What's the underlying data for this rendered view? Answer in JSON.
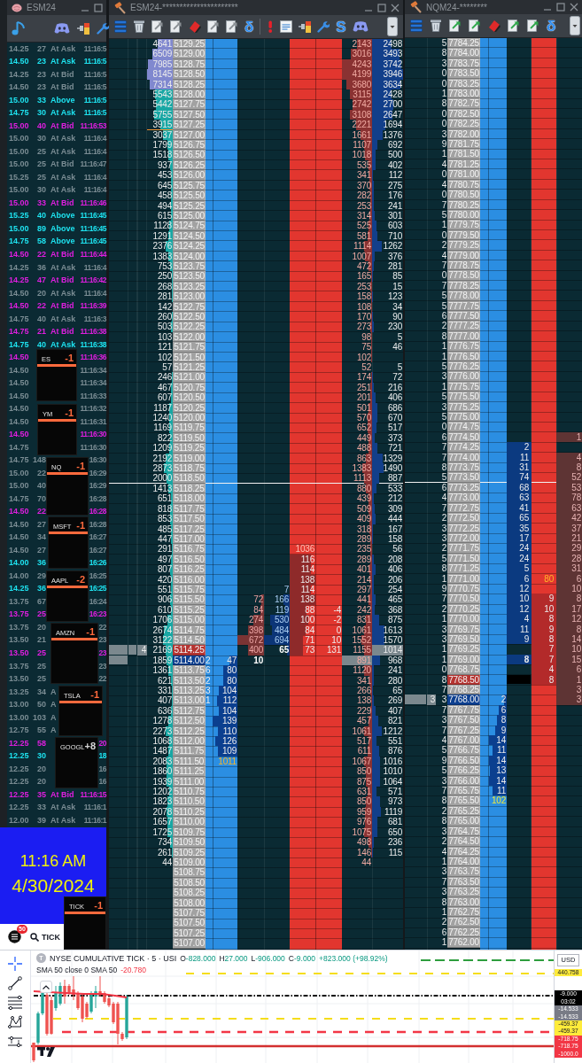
{
  "time_sales": {
    "title": "ESM24",
    "rows": [
      {
        "column_1": "14.25",
        "column_2": "27",
        "column_3": "At Ask",
        "column_4": "11:16:5",
        "color": "#7b8d94"
      },
      {
        "column_1": "14.50",
        "column_2": "23",
        "column_3": "At Ask",
        "column_4": "11:16:5",
        "color": "#1ee3f0"
      },
      {
        "column_1": "14.25",
        "column_2": "23",
        "column_3": "At Bid",
        "column_4": "11:16:5",
        "color": "#7b8d94"
      },
      {
        "column_1": "14.50",
        "column_2": "23",
        "column_3": "At Bid",
        "column_4": "11:16:5",
        "color": "#7b8d94"
      },
      {
        "column_1": "15.00",
        "column_2": "33",
        "column_3": "Above",
        "column_4": "11:16:5",
        "color": "#1ee3f0"
      },
      {
        "column_1": "14.75",
        "column_2": "30",
        "column_3": "At Ask",
        "column_4": "11:16:5",
        "color": "#1ee3f0"
      },
      {
        "column_1": "15.00",
        "column_2": "40",
        "column_3": "At Bid",
        "column_4": "11:16:53",
        "color": "#e01ee0"
      },
      {
        "column_1": "15.00",
        "column_2": "30",
        "column_3": "At Ask",
        "column_4": "11:16:4",
        "color": "#7b8d94"
      },
      {
        "column_1": "15.00",
        "column_2": "25",
        "column_3": "At Ask",
        "column_4": "11:16:4",
        "color": "#7b8d94"
      },
      {
        "column_1": "15.00",
        "column_2": "25",
        "column_3": "At Bid",
        "column_4": "11:16:47",
        "color": "#7b8d94"
      },
      {
        "column_1": "15.25",
        "column_2": "25",
        "column_3": "At Ask",
        "column_4": "11:16:4",
        "color": "#7b8d94"
      },
      {
        "column_1": "15.00",
        "column_2": "30",
        "column_3": "At Ask",
        "column_4": "11:16:4",
        "color": "#7b8d94"
      },
      {
        "column_1": "15.00",
        "column_2": "33",
        "column_3": "At Bid",
        "column_4": "11:16:46",
        "color": "#e01ee0"
      },
      {
        "column_1": "15.25",
        "column_2": "40",
        "column_3": "Above",
        "column_4": "11:16:45",
        "color": "#1ee3f0"
      },
      {
        "column_1": "15.00",
        "column_2": "89",
        "column_3": "Above",
        "column_4": "11:16:45",
        "color": "#1ee3f0"
      },
      {
        "column_1": "14.75",
        "column_2": "58",
        "column_3": "Above",
        "column_4": "11:16:45",
        "color": "#1ee3f0"
      },
      {
        "column_1": "14.50",
        "column_2": "22",
        "column_3": "At Bid",
        "column_4": "11:16:44",
        "color": "#e01ee0"
      },
      {
        "column_1": "14.25",
        "column_2": "36",
        "column_3": "At Ask",
        "column_4": "11:16:4",
        "color": "#7b8d94"
      },
      {
        "column_1": "14.25",
        "column_2": "47",
        "column_3": "At Bid",
        "column_4": "11:16:42",
        "color": "#e01ee0"
      },
      {
        "column_1": "14.50",
        "column_2": "20",
        "column_3": "At Ask",
        "column_4": "11:16:4",
        "color": "#7b8d94"
      },
      {
        "column_1": "14.50",
        "column_2": "22",
        "column_3": "At Bid",
        "column_4": "11:16:39",
        "color": "#e01ee0"
      },
      {
        "column_1": "14.75",
        "column_2": "40",
        "column_3": "At Ask",
        "column_4": "11:16:3",
        "color": "#7b8d94"
      },
      {
        "column_1": "14.75",
        "column_2": "21",
        "column_3": "At Bid",
        "column_4": "11:16:38",
        "color": "#e01ee0"
      },
      {
        "column_1": "14.75",
        "column_2": "40",
        "column_3": "At Ask",
        "column_4": "11:16:38",
        "color": "#1ee3f0"
      },
      {
        "column_1": "14.50",
        "column_4": "11:16:36",
        "color": "#e01ee0"
      },
      {
        "column_1": "14.50",
        "column_4": "11:16:34",
        "color": "#7b8d94"
      },
      {
        "column_1": "14.50",
        "column_4": "11:16:34",
        "color": "#7b8d94"
      },
      {
        "column_1": "14.50",
        "column_4": "11:16:33",
        "color": "#7b8d94"
      },
      {
        "column_1": "14.50",
        "column_4": "11:16:32",
        "color": "#7b8d94"
      },
      {
        "column_1": "14.50",
        "column_4": "11:16:31",
        "color": "#7b8d94"
      },
      {
        "column_1": "14.50",
        "column_4": "11:16:30",
        "color": "#e01ee0"
      },
      {
        "column_1": "14.75",
        "column_4": "11:16:30",
        "color": "#7b8d94"
      },
      {
        "column_1": "14.75",
        "column_2": "148",
        "column_4": "16:30",
        "color": "#7b8d94"
      },
      {
        "column_1": "15.00",
        "column_2": "22",
        "column_4": "16:29",
        "color": "#7b8d94"
      },
      {
        "column_1": "15.00",
        "column_2": "40",
        "column_4": "16:29",
        "color": "#7b8d94"
      },
      {
        "column_1": "14.75",
        "column_2": "70",
        "column_4": "16:28",
        "color": "#7b8d94"
      },
      {
        "column_1": "14.50",
        "column_2": "22",
        "column_4": "16:28",
        "color": "#e01ee0"
      },
      {
        "column_1": "14.50",
        "column_2": "27",
        "column_4": "16:28",
        "color": "#7b8d94"
      },
      {
        "column_1": "14.50",
        "column_2": "34",
        "column_4": "16:27",
        "color": "#7b8d94"
      },
      {
        "column_1": "14.50",
        "column_2": "27",
        "column_4": "16:27",
        "color": "#7b8d94"
      },
      {
        "column_1": "14.00",
        "column_2": "36",
        "column_4": "16:26",
        "color": "#1ee3f0"
      },
      {
        "column_1": "14.00",
        "column_2": "29",
        "column_4": "16:25",
        "color": "#7b8d94"
      },
      {
        "column_1": "14.25",
        "column_2": "36",
        "column_4": "16:25",
        "color": "#1ee3f0"
      },
      {
        "column_1": "13.75",
        "column_2": "67",
        "column_4": "16:24",
        "color": "#7b8d94"
      },
      {
        "column_1": "13.75",
        "column_2": "25",
        "column_4": "16:23",
        "color": "#e01ee0"
      },
      {
        "column_1": "13.75",
        "column_2": "20",
        "column_4": "22",
        "color": "#7b8d94"
      },
      {
        "column_1": "13.50",
        "column_2": "21",
        "column_4": "23",
        "color": "#7b8d94"
      },
      {
        "column_1": "13.50",
        "column_2": "25",
        "column_4": "23",
        "color": "#e01ee0"
      },
      {
        "column_1": "13.75",
        "column_2": "25",
        "column_4": "23",
        "color": "#7b8d94"
      },
      {
        "column_1": "13.50",
        "column_2": "25",
        "column_4": "22",
        "color": "#7b8d94"
      },
      {
        "column_1": "13.25",
        "column_2": "34",
        "column_3": "A",
        "color": "#7b8d94"
      },
      {
        "column_1": "13.00",
        "column_2": "50",
        "column_3": "A",
        "color": "#7b8d94"
      },
      {
        "column_1": "13.00",
        "column_2": "103",
        "column_3": "A",
        "color": "#7b8d94"
      },
      {
        "column_1": "12.75",
        "column_2": "55",
        "column_3": "A",
        "color": "#7b8d94"
      },
      {
        "column_1": "12.25",
        "column_2": "58",
        "column_4": "20",
        "color": "#e01ee0"
      },
      {
        "column_1": "12.25",
        "column_2": "30",
        "column_4": "18",
        "color": "#1ee3f0"
      },
      {
        "column_1": "12.25",
        "column_2": "20",
        "column_4": "16",
        "color": "#7b8d94"
      },
      {
        "column_1": "12.25",
        "column_2": "20",
        "column_4": "16",
        "color": "#7b8d94"
      },
      {
        "column_1": "12.25",
        "column_2": "35",
        "column_3": "At Bid",
        "column_4": "11:16:15",
        "color": "#e01ee0"
      },
      {
        "column_1": "12.25",
        "column_2": "33",
        "column_3": "At Ask",
        "column_4": "11:16:1",
        "color": "#7b8d94"
      },
      {
        "column_1": "12.00",
        "column_2": "39",
        "column_3": "At Ask",
        "column_4": "11:16:1",
        "color": "#7b8d94"
      }
    ]
  },
  "overlays": [
    {
      "label": "ES",
      "value": "-1",
      "color": "#ff6a3d",
      "underlined": true
    },
    {
      "label": "YM",
      "value": "-1",
      "color": "#ff6a3d",
      "underlined": true
    },
    {
      "label": "NQ",
      "value": "-1",
      "color": "#ff6a3d",
      "underlined": true
    },
    {
      "label": "MSFT",
      "value": "-1",
      "color": "#ff6a3d",
      "underlined": true
    },
    {
      "label": "AAPL",
      "value": "-2",
      "color": "#ff6a3d",
      "underlined": true
    },
    {
      "label": "AMZN",
      "value": "-1",
      "color": "#ff6a3d",
      "underlined": true
    },
    {
      "label": "TSLA",
      "value": "-1",
      "color": "#ff6a3d",
      "underlined": true
    },
    {
      "label": "GOOGL",
      "value": "+8",
      "color": "#d6d6d6",
      "underlined": false
    },
    {
      "label": "TICK",
      "value": "-1",
      "color": "#ff6a3d",
      "underlined": true
    }
  ],
  "clock": {
    "time": "11:16 AM",
    "date": "4/30/2024"
  },
  "browser": {
    "badge": "50",
    "search": "TICK"
  },
  "es_ladder": {
    "title": "ESM24-**********************",
    "toolbar_labels": [
      "δ",
      "S"
    ],
    "rows": [
      {
        "column_4": "4641",
        "column_5": "5129.25",
        "column_12": "2143",
        "column_13": "2498",
        "kind": "shaded"
      },
      {
        "column_4": "6509",
        "column_5": "5129.00",
        "column_12": "3016",
        "column_13": "3493",
        "kind": "shaded"
      },
      {
        "column_4": "7985",
        "column_5": "5128.75",
        "column_12": "4243",
        "column_13": "3742",
        "kind": "shaded"
      },
      {
        "column_4": "8145",
        "column_5": "5128.50",
        "column_12": "4199",
        "column_13": "3946",
        "kind": "shaded"
      },
      {
        "column_4": "7314",
        "column_5": "5128.25",
        "column_12": "3680",
        "column_13": "3634",
        "kind": "shaded"
      },
      {
        "column_4": "5543",
        "column_5": "5128.00",
        "column_12": "3115",
        "column_13": "2428",
        "kind": "level"
      },
      {
        "column_4": "5442",
        "column_5": "5127.75",
        "column_12": "2742",
        "column_13": "2700",
        "kind": "level"
      },
      {
        "column_4": "5755",
        "column_5": "5127.50",
        "column_12": "3108",
        "column_13": "2647",
        "kind": "level"
      },
      {
        "column_4": "3915",
        "column_5": "5127.25",
        "column_12": "2221",
        "column_13": "1694",
        "kind": "tick"
      },
      {
        "column_4": "3037",
        "column_5": "5127.00",
        "column_12": "1661",
        "column_13": "1376",
        "kind": "level"
      },
      {
        "column_4": "1799",
        "column_5": "5126.75",
        "column_12": "1107",
        "column_13": "692",
        "kind": "level"
      },
      {
        "column_4": "1518",
        "column_5": "5126.50",
        "column_12": "1018",
        "column_13": "500",
        "kind": "level"
      },
      {
        "column_4": "937",
        "column_5": "5126.25",
        "column_12": "535",
        "column_13": "402",
        "kind": "level"
      },
      {
        "column_4": "453",
        "column_5": "5126.00",
        "column_12": "341",
        "column_13": "112",
        "kind": "level"
      },
      {
        "column_4": "645",
        "column_5": "5125.75",
        "column_12": "370",
        "column_13": "275",
        "kind": "level"
      },
      {
        "column_4": "458",
        "column_5": "5125.50",
        "column_12": "282",
        "column_13": "176",
        "kind": "level"
      },
      {
        "column_4": "494",
        "column_5": "5125.25",
        "column_12": "253",
        "column_13": "241",
        "kind": "level"
      },
      {
        "column_4": "615",
        "column_5": "5125.00",
        "column_12": "314",
        "column_13": "301",
        "kind": "level"
      },
      {
        "column_4": "1128",
        "column_5": "5124.75",
        "column_12": "525",
        "column_13": "603",
        "kind": "level"
      },
      {
        "column_4": "1291",
        "column_5": "5124.50",
        "column_12": "581",
        "column_13": "710",
        "kind": "level"
      },
      {
        "column_4": "2376",
        "column_5": "5124.25",
        "column_12": "1114",
        "column_13": "1262",
        "kind": "level"
      },
      {
        "column_4": "1383",
        "column_5": "5124.00",
        "column_12": "1007",
        "column_13": "376",
        "kind": "level"
      },
      {
        "column_4": "753",
        "column_5": "5123.75",
        "column_12": "472",
        "column_13": "281",
        "kind": "level"
      },
      {
        "column_4": "250",
        "column_5": "5123.50",
        "column_12": "165",
        "column_13": "85",
        "kind": "level"
      },
      {
        "column_4": "268",
        "column_5": "5123.25",
        "column_12": "253",
        "column_13": "15",
        "kind": "level"
      },
      {
        "column_4": "281",
        "column_5": "5123.00",
        "column_12": "158",
        "column_13": "123",
        "kind": "level"
      },
      {
        "column_4": "142",
        "column_5": "5122.75",
        "column_12": "108",
        "column_13": "34",
        "kind": "level"
      },
      {
        "column_4": "260",
        "column_5": "5122.50",
        "column_12": "170",
        "column_13": "90",
        "kind": "level"
      },
      {
        "column_4": "503",
        "column_5": "5122.25",
        "column_12": "273",
        "column_13": "230",
        "kind": "level"
      },
      {
        "column_4": "103",
        "column_5": "5122.00",
        "column_12": "98",
        "column_13": "5",
        "kind": "level"
      },
      {
        "column_4": "121",
        "column_5": "5121.75",
        "column_12": "75",
        "column_13": "46",
        "kind": "level"
      },
      {
        "column_4": "102",
        "column_5": "5121.50",
        "column_12": "102",
        "kind": "level"
      },
      {
        "column_4": "57",
        "column_5": "5121.25",
        "column_12": "52",
        "column_13": "5",
        "kind": "level"
      },
      {
        "column_4": "246",
        "column_5": "5121.00",
        "column_12": "174",
        "column_13": "72",
        "kind": "level"
      },
      {
        "column_4": "467",
        "column_5": "5120.75",
        "column_12": "251",
        "column_13": "216",
        "kind": "level"
      },
      {
        "column_4": "607",
        "column_5": "5120.50",
        "column_12": "201",
        "column_13": "406",
        "kind": "level"
      },
      {
        "column_4": "1187",
        "column_5": "5120.25",
        "column_12": "501",
        "column_13": "686",
        "kind": "level"
      },
      {
        "column_4": "1240",
        "column_5": "5120.00",
        "column_12": "570",
        "column_13": "670",
        "kind": "level"
      },
      {
        "column_4": "1169",
        "column_5": "5119.75",
        "column_12": "652",
        "column_13": "517",
        "kind": "level"
      },
      {
        "column_4": "822",
        "column_5": "5119.50",
        "column_12": "449",
        "column_13": "373",
        "kind": "level"
      },
      {
        "column_4": "1209",
        "column_5": "5119.25",
        "column_12": "488",
        "column_13": "721",
        "kind": "level"
      },
      {
        "column_4": "2192",
        "column_5": "5119.00",
        "column_12": "863",
        "column_13": "1329",
        "kind": "level"
      },
      {
        "column_4": "2873",
        "column_5": "5118.75",
        "column_12": "1383",
        "column_13": "1490",
        "kind": "level"
      },
      {
        "column_4": "2000",
        "column_5": "5118.50",
        "column_12": "1113",
        "column_13": "887",
        "kind": "line"
      },
      {
        "column_4": "1413",
        "column_5": "5118.25",
        "column_12": "880",
        "column_13": "533",
        "kind": "level"
      },
      {
        "column_4": "651",
        "column_5": "5118.00",
        "column_12": "439",
        "column_13": "212",
        "kind": "level"
      },
      {
        "column_4": "818",
        "column_5": "5117.75",
        "column_12": "509",
        "column_13": "309",
        "kind": "level"
      },
      {
        "column_4": "853",
        "column_5": "5117.50",
        "column_12": "409",
        "column_13": "444",
        "kind": "level"
      },
      {
        "column_4": "485",
        "column_5": "5117.25",
        "column_12": "318",
        "column_13": "167",
        "kind": "level"
      },
      {
        "column_4": "447",
        "column_5": "5117.00",
        "column_12": "289",
        "column_13": "158",
        "kind": "level"
      },
      {
        "column_4": "291",
        "column_5": "5116.75",
        "column_10": "1036",
        "column_12": "235",
        "column_13": "56",
        "kind": "large"
      },
      {
        "column_4": "497",
        "column_5": "5116.50",
        "column_10": "116",
        "column_12": "289",
        "column_13": "208",
        "kind": "level"
      },
      {
        "column_4": "807",
        "column_5": "5116.25",
        "column_10": "114",
        "column_12": "401",
        "column_13": "406",
        "kind": "level"
      },
      {
        "column_4": "420",
        "column_5": "5116.00",
        "column_10": "138",
        "column_12": "214",
        "column_13": "206",
        "kind": "level"
      },
      {
        "column_4": "551",
        "column_5": "5115.75",
        "column_9": "7",
        "column_10": "114",
        "column_12": "297",
        "column_13": "254",
        "kind": "level"
      },
      {
        "column_4": "906",
        "column_5": "5115.50",
        "column_8": "72",
        "column_9": "166",
        "column_10": "138",
        "column_12": "441",
        "column_13": "465",
        "kind": "level"
      },
      {
        "column_4": "610",
        "column_5": "5115.25",
        "column_8": "84",
        "column_9": "119",
        "column_10": "88",
        "column_11": "-4",
        "column_12": "242",
        "column_13": "368",
        "kind": "level"
      },
      {
        "column_4": "1706",
        "column_5": "5115.00",
        "column_8": "274",
        "column_9": "530",
        "column_10": "100",
        "column_11": "-2",
        "column_12": "831",
        "column_13": "875",
        "kind": "level"
      },
      {
        "column_4": "2674",
        "column_5": "5114.75",
        "column_8": "398",
        "column_9": "484",
        "column_10": "84",
        "column_11": "0",
        "column_12": "1061",
        "column_13": "1613",
        "kind": "level"
      },
      {
        "column_4": "3122",
        "column_5": "5114.50",
        "column_8": "672",
        "column_9": "694",
        "column_10": "71",
        "column_11": "10",
        "column_12": "1552",
        "column_13": "1570",
        "kind": "level"
      },
      {
        "column_3": "4",
        "column_4": "2169",
        "column_5": "5114.25",
        "column_8": "400",
        "column_9": "65",
        "column_10": "73",
        "column_11": "131",
        "column_12": "1155",
        "column_13": "1014",
        "kind": "best_ask"
      },
      {
        "column_4": "1859",
        "column_5": "5114.00",
        "column_6": "2",
        "column_7": "47",
        "column_8": "10",
        "column_12": "891",
        "column_13": "968",
        "kind": "best_bid"
      },
      {
        "column_4": "1361",
        "column_5": "5113.75",
        "column_6": "6",
        "column_7": "80",
        "column_12": "1120",
        "column_13": "241",
        "kind": "level"
      },
      {
        "column_4": "621",
        "column_5": "5113.50",
        "column_6": "2",
        "column_7": "80",
        "column_12": "341",
        "column_13": "280",
        "kind": "level"
      },
      {
        "column_4": "331",
        "column_5": "5113.25",
        "column_6": "3",
        "column_7": "104",
        "column_12": "266",
        "column_13": "65",
        "kind": "level"
      },
      {
        "column_4": "407",
        "column_5": "5113.00",
        "column_6": "1",
        "column_7": "112",
        "column_12": "138",
        "column_13": "269",
        "kind": "level"
      },
      {
        "column_4": "636",
        "column_5": "5112.75",
        "column_7": "104",
        "column_12": "229",
        "column_13": "407",
        "kind": "level"
      },
      {
        "column_4": "1278",
        "column_5": "5112.50",
        "column_7": "139",
        "column_12": "457",
        "column_13": "821",
        "kind": "level"
      },
      {
        "column_4": "2273",
        "column_5": "5112.25",
        "column_7": "110",
        "column_12": "1061",
        "column_13": "1212",
        "kind": "level"
      },
      {
        "column_4": "1068",
        "column_5": "5112.00",
        "column_7": "126",
        "column_12": "517",
        "column_13": "551",
        "kind": "level"
      },
      {
        "column_4": "1487",
        "column_5": "5111.75",
        "column_7": "109",
        "column_12": "611",
        "column_13": "876",
        "kind": "level"
      },
      {
        "column_4": "2083",
        "column_5": "5111.50",
        "column_7": "1011",
        "column_12": "1067",
        "column_13": "1016",
        "kind": "large"
      },
      {
        "column_4": "1860",
        "column_5": "5111.25",
        "column_12": "850",
        "column_13": "1010",
        "kind": "level"
      },
      {
        "column_4": "1939",
        "column_5": "5111.00",
        "column_12": "875",
        "column_13": "1064",
        "kind": "level"
      },
      {
        "column_4": "1202",
        "column_5": "5110.75",
        "column_12": "631",
        "column_13": "571",
        "kind": "level"
      },
      {
        "column_4": "1823",
        "column_5": "5110.50",
        "column_12": "850",
        "column_13": "973",
        "kind": "level"
      },
      {
        "column_4": "2078",
        "column_5": "5110.25",
        "column_12": "959",
        "column_13": "1119",
        "kind": "level"
      },
      {
        "column_4": "1657",
        "column_5": "5110.00",
        "column_12": "976",
        "column_13": "681",
        "kind": "level"
      },
      {
        "column_4": "1725",
        "column_5": "5109.75",
        "column_12": "1075",
        "column_13": "650",
        "kind": "level"
      },
      {
        "column_4": "734",
        "column_5": "5109.50",
        "column_12": "498",
        "column_13": "236",
        "kind": "level"
      },
      {
        "column_4": "261",
        "column_5": "5109.25",
        "column_12": "146",
        "column_13": "115",
        "kind": "level"
      },
      {
        "column_4": "44",
        "column_5": "5109.00",
        "column_12": "44",
        "kind": "level"
      },
      {
        "column_5": "5108.75",
        "kind": "level"
      },
      {
        "column_5": "5108.50",
        "kind": "level"
      },
      {
        "column_5": "5108.25",
        "kind": "level"
      },
      {
        "column_5": "5108.00",
        "kind": "level"
      },
      {
        "column_5": "5107.75",
        "kind": "level"
      },
      {
        "column_5": "5107.50",
        "kind": "level"
      },
      {
        "column_5": "5107.25",
        "kind": "level"
      },
      {
        "column_5": "5107.00",
        "kind": "level"
      }
    ]
  },
  "nq_ladder": {
    "title": "NQM24-********",
    "toolbar_labels": [
      "δ"
    ],
    "rows": [
      {
        "column_3": "5",
        "column_4": "7784.25",
        "kind": "level"
      },
      {
        "column_3": "8",
        "column_4": "7784.00",
        "kind": "level"
      },
      {
        "column_3": "3",
        "column_4": "7783.75",
        "kind": "level"
      },
      {
        "column_3": "0",
        "column_4": "7783.50",
        "kind": "level"
      },
      {
        "column_3": "0",
        "column_4": "7783.25",
        "kind": "level"
      },
      {
        "column_3": "1",
        "column_4": "7783.00",
        "kind": "level"
      },
      {
        "column_3": "8",
        "column_4": "7782.75",
        "kind": "level"
      },
      {
        "column_3": "0",
        "column_4": "7782.50",
        "kind": "level"
      },
      {
        "column_3": "0",
        "column_4": "7782.25",
        "kind": "level"
      },
      {
        "column_3": "3",
        "column_4": "7782.00",
        "kind": "level"
      },
      {
        "column_3": "9",
        "column_4": "7781.75",
        "kind": "level"
      },
      {
        "column_3": "1",
        "column_4": "7781.50",
        "kind": "level"
      },
      {
        "column_3": "4",
        "column_4": "7781.25",
        "kind": "level"
      },
      {
        "column_3": "0",
        "column_4": "7781.00",
        "kind": "level"
      },
      {
        "column_3": "4",
        "column_4": "7780.75",
        "kind": "level"
      },
      {
        "column_3": "0",
        "column_4": "7780.50",
        "kind": "level"
      },
      {
        "column_3": "7",
        "column_4": "7780.25",
        "kind": "level"
      },
      {
        "column_3": "5",
        "column_4": "7780.00",
        "kind": "level"
      },
      {
        "column_3": "1",
        "column_4": "7779.75",
        "kind": "level"
      },
      {
        "column_3": "0",
        "column_4": "7779.50",
        "kind": "level"
      },
      {
        "column_3": "2",
        "column_4": "7779.25",
        "kind": "level"
      },
      {
        "column_3": "4",
        "column_4": "7779.00",
        "kind": "level"
      },
      {
        "column_3": "7",
        "column_4": "7778.75",
        "kind": "level"
      },
      {
        "column_3": "0",
        "column_4": "7778.50",
        "kind": "level"
      },
      {
        "column_3": "7",
        "column_4": "7778.25",
        "kind": "level"
      },
      {
        "column_3": "5",
        "column_4": "7778.00",
        "kind": "level"
      },
      {
        "column_3": "5",
        "column_4": "7777.75",
        "kind": "level"
      },
      {
        "column_3": "6",
        "column_4": "7777.50",
        "kind": "level"
      },
      {
        "column_3": "2",
        "column_4": "7777.25",
        "kind": "level"
      },
      {
        "column_3": "8",
        "column_4": "7777.00",
        "kind": "level"
      },
      {
        "column_3": "1",
        "column_4": "7776.75",
        "kind": "level"
      },
      {
        "column_3": "1",
        "column_4": "7776.50",
        "kind": "level"
      },
      {
        "column_3": "5",
        "column_4": "7776.25",
        "kind": "level"
      },
      {
        "column_3": "3",
        "column_4": "7776.00",
        "kind": "level"
      },
      {
        "column_3": "1",
        "column_4": "7775.75",
        "kind": "level"
      },
      {
        "column_3": "5",
        "column_4": "7775.50",
        "kind": "level"
      },
      {
        "column_3": "3",
        "column_4": "7775.25",
        "kind": "level"
      },
      {
        "column_3": "5",
        "column_4": "7775.00",
        "kind": "level"
      },
      {
        "column_3": "0",
        "column_4": "7774.75",
        "kind": "level"
      },
      {
        "column_3": "6",
        "column_4": "7774.50",
        "column_9": "1",
        "kind": "level"
      },
      {
        "column_3": "7",
        "column_4": "7774.25",
        "column_7": "2",
        "kind": "level"
      },
      {
        "column_3": "7",
        "column_4": "7774.00",
        "column_7": "11",
        "column_9": "4",
        "kind": "level"
      },
      {
        "column_3": "8",
        "column_4": "7773.75",
        "column_7": "31",
        "column_9": "8",
        "kind": "level"
      },
      {
        "column_3": "5",
        "column_4": "7773.50",
        "column_7": "74",
        "column_9": "52",
        "kind": "line"
      },
      {
        "column_3": "6",
        "column_4": "7773.25",
        "column_7": "68",
        "column_9": "53",
        "kind": "level"
      },
      {
        "column_3": "4",
        "column_4": "7773.00",
        "column_7": "63",
        "column_9": "78",
        "kind": "level"
      },
      {
        "column_3": "7",
        "column_4": "7772.75",
        "column_7": "41",
        "column_9": "63",
        "kind": "level"
      },
      {
        "column_3": "2",
        "column_4": "7772.50",
        "column_7": "65",
        "column_9": "42",
        "kind": "level"
      },
      {
        "column_3": "3",
        "column_4": "7772.25",
        "column_7": "35",
        "column_9": "37",
        "kind": "level"
      },
      {
        "column_3": "3",
        "column_4": "7772.00",
        "column_7": "17",
        "column_9": "21",
        "kind": "level"
      },
      {
        "column_3": "2",
        "column_4": "7771.75",
        "column_7": "24",
        "column_9": "29",
        "kind": "level"
      },
      {
        "column_3": "5",
        "column_4": "7771.50",
        "column_7": "24",
        "column_9": "28",
        "kind": "level"
      },
      {
        "column_3": "8",
        "column_4": "7771.25",
        "column_7": "5",
        "column_9": "31",
        "kind": "level"
      },
      {
        "column_3": "1",
        "column_4": "7771.00",
        "column_7": "6",
        "column_8": "80",
        "column_9": "6",
        "kind": "large"
      },
      {
        "column_3": "9",
        "column_4": "7770.75",
        "column_7": "12",
        "column_9": "10",
        "kind": "level"
      },
      {
        "column_3": "7",
        "column_4": "7770.50",
        "column_7": "10",
        "column_8": "9",
        "column_9": "8",
        "kind": "level"
      },
      {
        "column_3": "2",
        "column_4": "7770.25",
        "column_7": "12",
        "column_8": "10",
        "column_9": "17",
        "kind": "level"
      },
      {
        "column_3": "1",
        "column_4": "7770.00",
        "column_7": "4",
        "column_8": "8",
        "column_9": "12",
        "kind": "level"
      },
      {
        "column_3": "3",
        "column_4": "7769.75",
        "column_7": "11",
        "column_8": "9",
        "column_9": "8",
        "kind": "level"
      },
      {
        "column_3": "3",
        "column_4": "7769.50",
        "column_7": "9",
        "column_8": "8",
        "column_9": "14",
        "kind": "level"
      },
      {
        "column_3": "1",
        "column_4": "7769.25",
        "column_8": "7",
        "column_9": "10",
        "kind": "level"
      },
      {
        "column_3": "1",
        "column_4": "7769.00",
        "column_7": "8",
        "column_8": "7",
        "column_9": "15",
        "kind": "last"
      },
      {
        "column_3": "0",
        "column_4": "7768.75",
        "column_8": "4",
        "column_9": "6",
        "kind": "level"
      },
      {
        "column_3": "8",
        "column_4": "7768.50",
        "column_8": "8",
        "column_9": "1",
        "kind": "best_ask"
      },
      {
        "column_3": "7",
        "column_4": "7768.25",
        "column_9": "3",
        "kind": "level"
      },
      {
        "column_2": "3",
        "column_3": "3",
        "column_4": "7768.00",
        "column_6": "2",
        "column_9": "3",
        "kind": "best_bid"
      },
      {
        "column_3": "7",
        "column_4": "7767.75",
        "column_6": "6",
        "kind": "level"
      },
      {
        "column_3": "3",
        "column_4": "7767.50",
        "column_6": "8",
        "kind": "level"
      },
      {
        "column_3": "7",
        "column_4": "7767.25",
        "column_6": "9",
        "kind": "level"
      },
      {
        "column_3": "4",
        "column_4": "7767.00",
        "column_6": "14",
        "kind": "level"
      },
      {
        "column_3": "5",
        "column_4": "7766.75",
        "column_6": "11",
        "kind": "level"
      },
      {
        "column_3": "9",
        "column_4": "7766.50",
        "column_6": "14",
        "kind": "level"
      },
      {
        "column_3": "5",
        "column_4": "7766.25",
        "column_6": "13",
        "kind": "level"
      },
      {
        "column_3": "3",
        "column_4": "7766.00",
        "column_6": "14",
        "kind": "level"
      },
      {
        "column_3": "7",
        "column_4": "7765.75",
        "column_6": "11",
        "kind": "level"
      },
      {
        "column_3": "8",
        "column_4": "7765.50",
        "column_6": "102",
        "kind": "large"
      },
      {
        "column_3": "2",
        "column_4": "7765.25",
        "kind": "level"
      },
      {
        "column_3": "8",
        "column_4": "7765.00",
        "kind": "level"
      },
      {
        "column_3": "3",
        "column_4": "7764.75",
        "kind": "level"
      },
      {
        "column_3": "2",
        "column_4": "7764.50",
        "kind": "level"
      },
      {
        "column_3": "4",
        "column_4": "7764.25",
        "kind": "level"
      },
      {
        "column_3": "1",
        "column_4": "7764.00",
        "kind": "level"
      },
      {
        "column_3": "3",
        "column_4": "7763.75",
        "kind": "level"
      },
      {
        "column_3": "7",
        "column_4": "7763.50",
        "kind": "level"
      },
      {
        "column_3": "3",
        "column_4": "7763.25",
        "kind": "level"
      },
      {
        "column_3": "8",
        "column_4": "7763.00",
        "kind": "level"
      },
      {
        "column_3": "1",
        "column_4": "7762.75",
        "kind": "level"
      },
      {
        "column_3": "2",
        "column_4": "7762.50",
        "kind": "level"
      },
      {
        "column_3": "6",
        "column_4": "7762.25",
        "kind": "level"
      },
      {
        "column_3": "1",
        "column_4": "7762.00",
        "kind": "level"
      }
    ]
  },
  "chart": {
    "symbol_logo": "T",
    "title": "NYSE CUMULATIVE TICK · 5 · USI",
    "ohlc": [
      {
        "label": "O",
        "value": "-828.000"
      },
      {
        "label": "H",
        "value": "27.000"
      },
      {
        "label": "L",
        "value": "-906.000"
      },
      {
        "label": "C",
        "value": "-9.000"
      }
    ],
    "change": "+823.000 (+98.92%)",
    "indicator": {
      "label": "SMA 50 close 0 SMA 50",
      "value": "-20.780"
    },
    "price_labels": [
      {
        "text": "USD",
        "kind": "currency",
        "color": "#ffffff"
      },
      {
        "text": "440.758",
        "kind": "label",
        "color": "#ffeb3b"
      },
      {
        "text": "-9.000",
        "kind": "label",
        "color": "#000000"
      },
      {
        "text": "03:02",
        "kind": "label",
        "color": "#000000"
      },
      {
        "text": "-14.533",
        "kind": "label",
        "color": "#787b86"
      },
      {
        "text": "-14.533",
        "kind": "label",
        "color": "#787b86"
      },
      {
        "text": "-459.37",
        "kind": "label",
        "color": "#ffeb3b"
      },
      {
        "text": "-459.37",
        "kind": "label",
        "color": "#ffeb3b"
      },
      {
        "text": "-718.75",
        "kind": "label",
        "color": "#f23645"
      },
      {
        "text": "-718.75",
        "kind": "label",
        "color": "#f23645"
      },
      {
        "text": "-1000.0",
        "kind": "label",
        "color": "#f23645"
      }
    ]
  }
}
